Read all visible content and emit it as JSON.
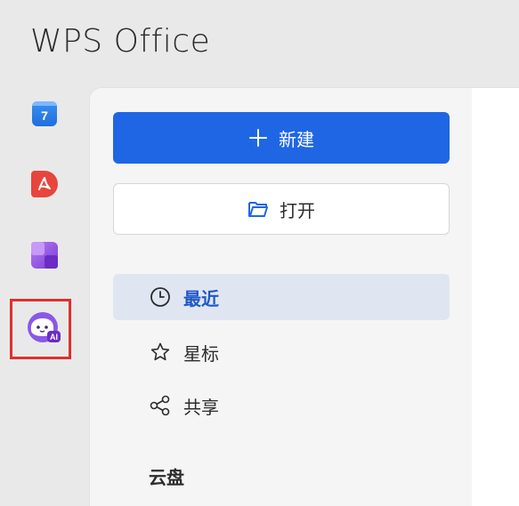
{
  "app": {
    "brand": "WPS Office"
  },
  "rail": {
    "calendar_icon": {
      "number": "7",
      "color": "#1f6fdc"
    },
    "pdf_icon": {
      "color": "#e8453c"
    },
    "apps_icon": {
      "color": "#8a4ae0"
    },
    "ai_icon": {
      "badge": "AI",
      "color": "#8a58e6",
      "highlight_color": "#e0302e"
    }
  },
  "actions": {
    "new_label": "新建",
    "open_label": "打开",
    "accent": "#1f66e5"
  },
  "nav": {
    "items": [
      {
        "label": "最近",
        "icon": "clock-icon",
        "active": true
      },
      {
        "label": "星标",
        "icon": "star-icon",
        "active": false
      },
      {
        "label": "共享",
        "icon": "share-icon",
        "active": false
      }
    ],
    "section_cloud": "云盘"
  }
}
